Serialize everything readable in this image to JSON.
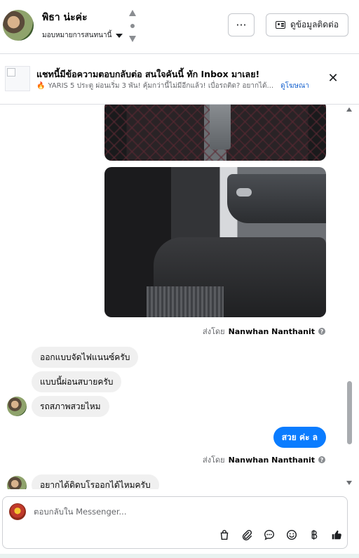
{
  "header": {
    "name": "พิธา น่ะค่ะ",
    "assign_label": "มอบหมายการสนทนานี้",
    "more_label": "···",
    "contact_label": "ดูข้อมูลติดต่อ"
  },
  "banner": {
    "title": "แชทนี้มีข้อความตอบกลับต่อ สนใจคันนี้ ทัก Inbox มาเลย!",
    "subtitle": "YARIS 5 ประตู ผ่อนเริ่ม 3 พัน! คุ้มกว่านี้ไม่มีอีกแล้ว! เบื่อรถติด? อยากได้...",
    "ad_link": "ดูโฆษณา",
    "close_label": "✕"
  },
  "messages": {
    "sent_by_prefix": "ส่งโดย",
    "sender_name": "Nanwhan Nanthanit",
    "help_mark": "?",
    "in_1": "ออกแบบจัดไฟแนนซ์ครับ",
    "in_2": "แบบนี้ผ่อนสบายครับ",
    "in_3": "รถสภาพสวยไหม",
    "out_1": "สวย ค่ะ  ล",
    "in_4": "อยากได้ดิดบโรออกได้ไหมครับ"
  },
  "composer": {
    "placeholder": "ตอบกลับใน Messenger..."
  },
  "colors": {
    "accent_blue": "#0a7cff",
    "link_blue": "#1763cf",
    "bubble_gray": "#f0f0f0"
  },
  "icons": {
    "tools": [
      "shopping-bag-icon",
      "paperclip-icon",
      "chat-bubble-icon",
      "smiley-icon",
      "baht-icon",
      "thumbs-up-icon"
    ]
  }
}
